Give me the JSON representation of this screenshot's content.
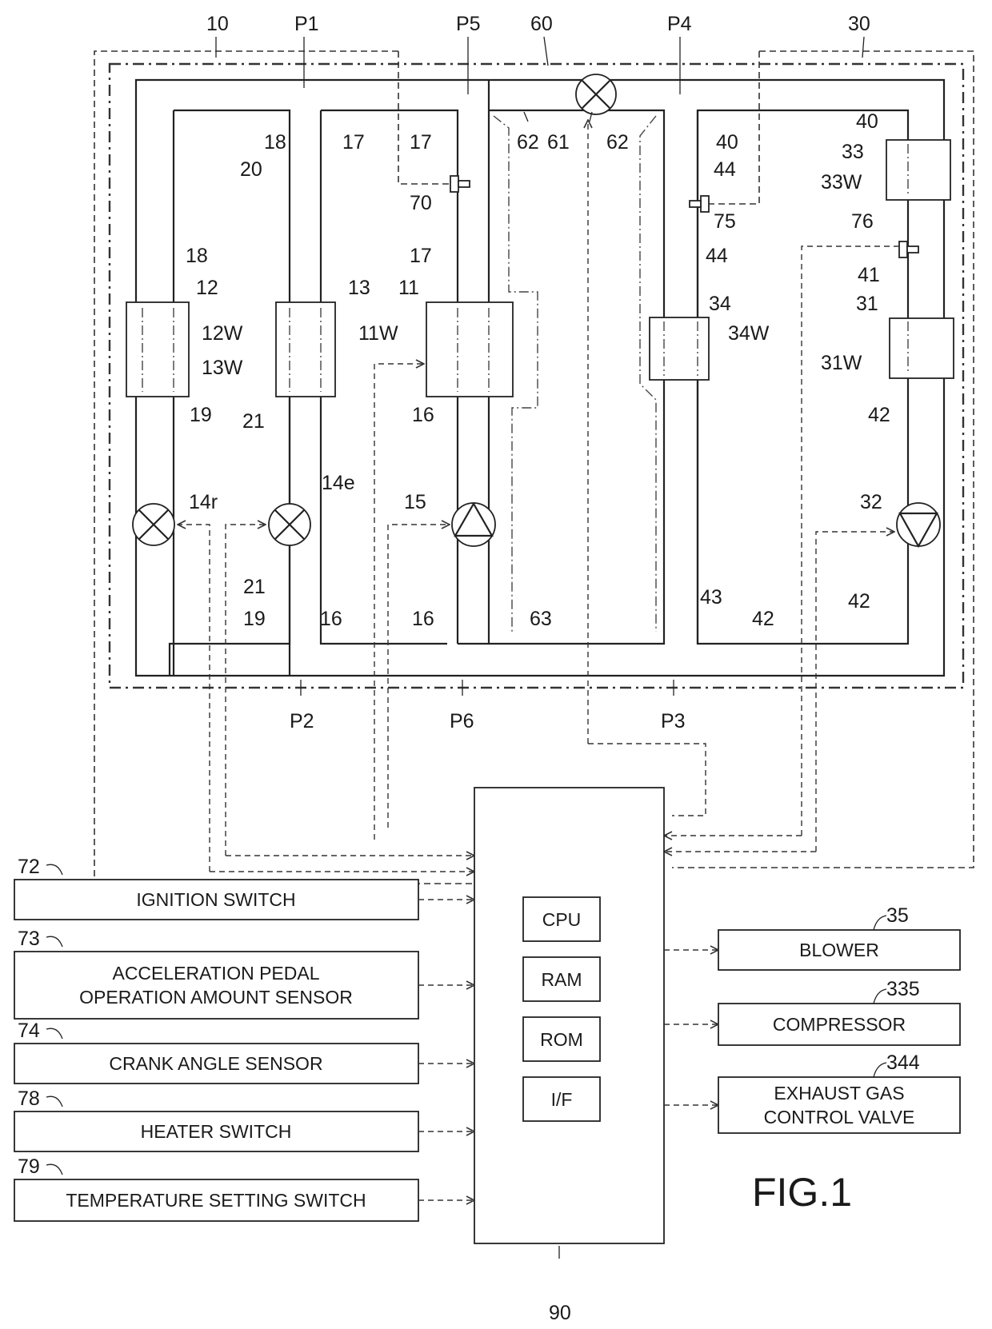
{
  "figure": {
    "title": "FIG.1"
  },
  "reference_labels": {
    "system_10": "10",
    "system_30": "30",
    "system_60": "60",
    "p1": "P1",
    "p2": "P2",
    "p3": "P3",
    "p4": "P4",
    "p5": "P5",
    "p6": "P6",
    "pipe_18_top": "18",
    "pipe_20": "20",
    "pipe_17_top": "17",
    "pipe_17_a": "17",
    "pipe_17_b": "17",
    "sensor_70": "70",
    "sensor_75": "75",
    "sensor_76": "76",
    "pipe_62_left": "62",
    "valve_61": "61",
    "pipe_62_right": "62",
    "pipe_40_top": "40",
    "pipe_44_top": "44",
    "pipe_44_mid": "44",
    "pipe_40_right": "40",
    "hx_33": "33",
    "hx_33w": "33W",
    "pipe_18_mid": "18",
    "hx_12": "12",
    "hx_12w": "12W",
    "hx_13": "13",
    "hx_13w": "13W",
    "hx_11": "11",
    "hx_11w": "11W",
    "hx_34": "34",
    "hx_34w": "34W",
    "pipe_41": "41",
    "hx_31": "31",
    "hx_31w": "31W",
    "pipe_19_mid": "19",
    "pipe_21_mid": "21",
    "pipe_16_mid": "16",
    "pipe_42_mid": "42",
    "valve_14r": "14r",
    "valve_14e": "14e",
    "pump_15": "15",
    "pump_32": "32",
    "pipe_21_low": "21",
    "pipe_19_low": "19",
    "pipe_16_low_a": "16",
    "pipe_16_low_b": "16",
    "pipe_63": "63",
    "pipe_43": "43",
    "pipe_42_low": "42",
    "pipe_42_right": "42",
    "ecu_90": "90",
    "ref_72": "72",
    "ref_73": "73",
    "ref_74": "74",
    "ref_78": "78",
    "ref_79": "79",
    "ref_35": "35",
    "ref_335": "335",
    "ref_344": "344"
  },
  "inputs": [
    {
      "ref": "72",
      "lines": [
        "IGNITION SWITCH"
      ]
    },
    {
      "ref": "73",
      "lines": [
        "ACCELERATION PEDAL",
        "OPERATION AMOUNT SENSOR"
      ]
    },
    {
      "ref": "74",
      "lines": [
        "CRANK ANGLE SENSOR"
      ]
    },
    {
      "ref": "78",
      "lines": [
        "HEATER SWITCH"
      ]
    },
    {
      "ref": "79",
      "lines": [
        "TEMPERATURE SETTING SWITCH"
      ]
    }
  ],
  "ecu": {
    "ref": "90",
    "modules": [
      "CPU",
      "RAM",
      "ROM",
      "I/F"
    ]
  },
  "outputs": [
    {
      "ref": "35",
      "lines": [
        "BLOWER"
      ]
    },
    {
      "ref": "335",
      "lines": [
        "COMPRESSOR"
      ]
    },
    {
      "ref": "344",
      "lines": [
        "EXHAUST GAS",
        "CONTROL VALVE"
      ]
    }
  ]
}
